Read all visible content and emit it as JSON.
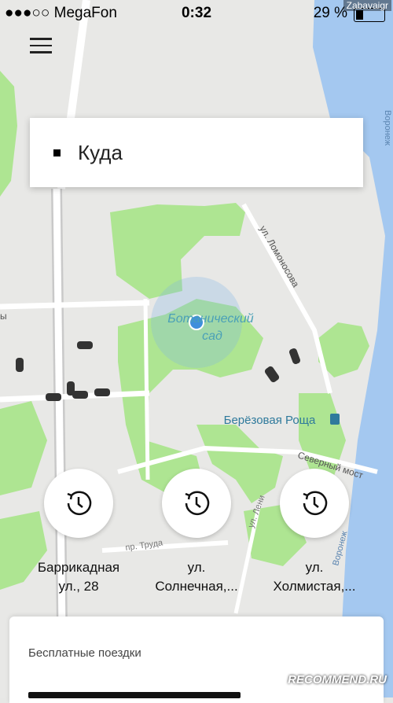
{
  "status_bar": {
    "carrier": "●●●○○ MegaFon",
    "time": "0:32",
    "battery_text": "29 %",
    "battery_level": 0.29,
    "watermark": "Zabavaigr"
  },
  "menu": {
    "icon": "hamburger-menu-icon"
  },
  "search": {
    "placeholder_label": "Куда"
  },
  "map": {
    "labels": {
      "garden_line1": "Ботанический",
      "garden_line2": "сад",
      "grove": "Берёзовая Роща",
      "street_lomonosova": "ул. Ломоносова",
      "street_severny": "Северный мост",
      "street_truda": "пр. Труда",
      "street_leni": "ул. Лени",
      "river1": "Воронеж",
      "river2": "Воронеж",
      "edge_label": "ы"
    }
  },
  "recent_places": [
    {
      "line1": "Баррикадная",
      "line2": "ул., 28",
      "icon": "history-clock-icon"
    },
    {
      "line1": "ул.",
      "line2": "Солнечная,...",
      "icon": "history-clock-icon"
    },
    {
      "line1": "ул.",
      "line2": "Холмистая,...",
      "icon": "history-clock-icon"
    }
  ],
  "bottom_card": {
    "title": "Бесплатные поездки"
  },
  "watermark_bottom": "RECOMMEND.RU"
}
